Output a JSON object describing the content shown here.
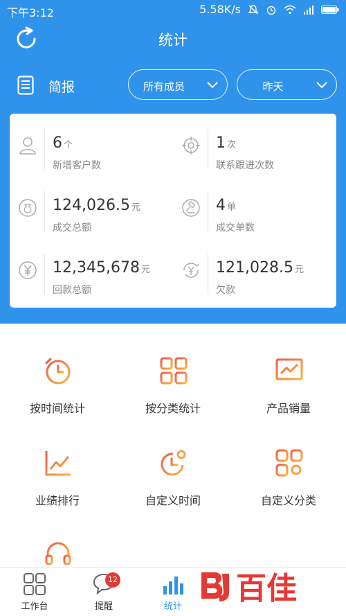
{
  "statusbar": {
    "time": "下午3:12",
    "speed": "5.58K/s"
  },
  "header": {
    "title": "统计"
  },
  "filters": {
    "report_label": "简报",
    "members": "所有成员",
    "date": "昨天"
  },
  "stats": [
    {
      "value": "6",
      "unit": "个",
      "label": "新增客户数",
      "icon": "person-icon"
    },
    {
      "value": "1",
      "unit": "次",
      "label": "联系跟进次数",
      "icon": "target-icon"
    },
    {
      "value": "124,026.5",
      "unit": "元",
      "label": "成交总额",
      "icon": "money-bag-icon"
    },
    {
      "value": "4",
      "unit": "单",
      "label": "成交单数",
      "icon": "gavel-icon"
    },
    {
      "value": "12,345,678",
      "unit": "元",
      "label": "回款总额",
      "icon": "yuan-coin-icon"
    },
    {
      "value": "121,028.5",
      "unit": "元",
      "label": "欠款",
      "icon": "yuan-cycle-icon"
    }
  ],
  "grid": [
    {
      "label": "按时间统计",
      "icon": "clock-icon"
    },
    {
      "label": "按分类统计",
      "icon": "category-icon"
    },
    {
      "label": "产品销量",
      "icon": "sales-chart-icon"
    },
    {
      "label": "业绩排行",
      "icon": "line-chart-icon"
    },
    {
      "label": "自定义时间",
      "icon": "clock-settings-icon"
    },
    {
      "label": "自定义分类",
      "icon": "category-settings-icon"
    },
    {
      "label": "",
      "icon": "headset-icon"
    }
  ],
  "tabs": [
    {
      "label": "工作台",
      "icon": "grid-icon"
    },
    {
      "label": "提醒",
      "icon": "chat-bubble-icon",
      "badge": "12"
    },
    {
      "label": "统计",
      "icon": "bar-chart-icon",
      "active": true
    }
  ],
  "watermark": {
    "text": "百佳"
  },
  "colors": {
    "primary": "#2f93ec",
    "accent_orange": "#f7a046",
    "accent_red": "#f15a4a",
    "badge": "#e53935"
  }
}
